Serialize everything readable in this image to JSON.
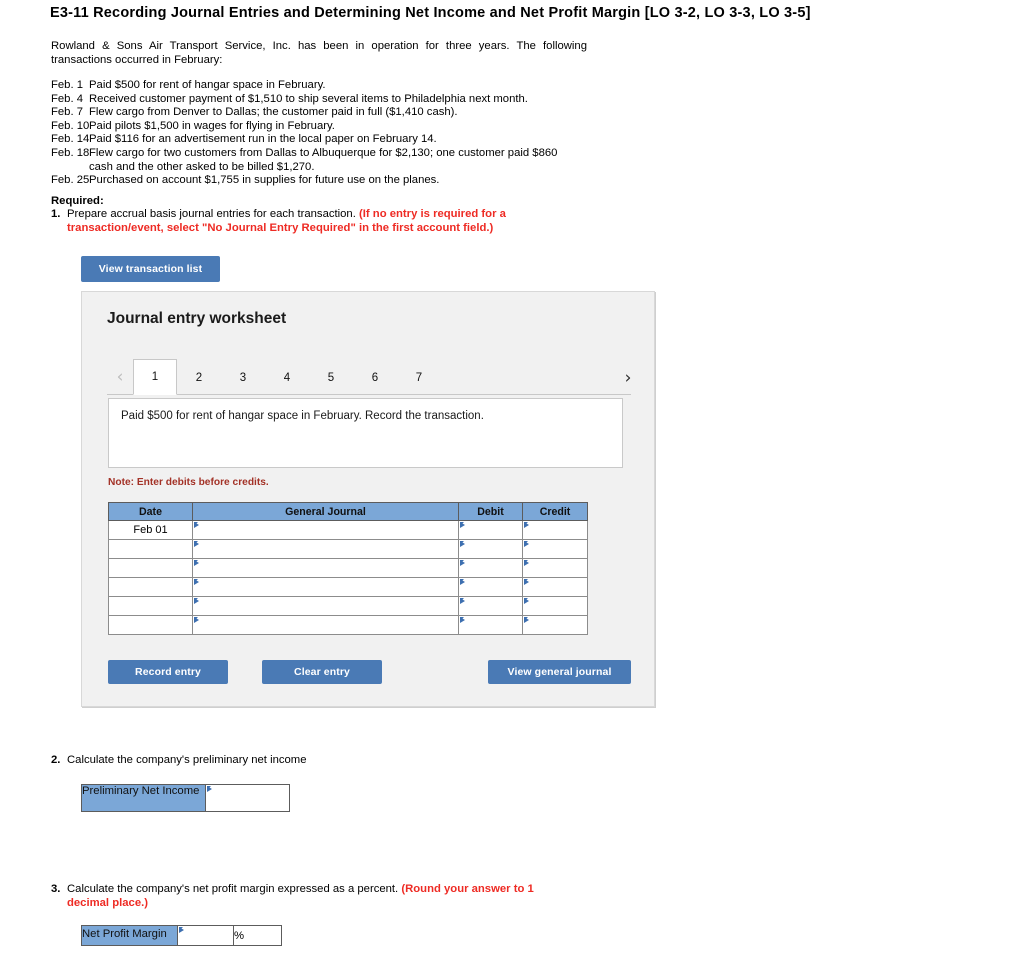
{
  "title": "E3-11 Recording Journal Entries and Determining Net Income and Net Profit Margin [LO 3-2, LO 3-3, LO 3-5]",
  "intro": "Rowland & Sons Air Transport Service, Inc. has been in operation for three years. The following transactions occurred in February:",
  "transactions": [
    {
      "date": "Feb. 1",
      "desc": "Paid $500 for rent of hangar space in February."
    },
    {
      "date": "Feb. 4",
      "desc": "Received customer payment of $1,510 to ship several items to Philadelphia next month."
    },
    {
      "date": "Feb. 7",
      "desc": "Flew cargo from Denver to Dallas; the customer paid in full ($1,410 cash)."
    },
    {
      "date": "Feb. 10",
      "desc": "Paid pilots $1,500 in wages for flying in February."
    },
    {
      "date": "Feb. 14",
      "desc": "Paid $116 for an advertisement run in the local paper on February 14."
    },
    {
      "date": "Feb. 18",
      "desc": "Flew cargo for two customers from Dallas to Albuquerque for $2,130; one customer paid $860",
      "cont": "cash and the other asked to be billed $1,270."
    },
    {
      "date": "Feb. 25",
      "desc": "Purchased on account $1,755 in supplies for future use on the planes."
    }
  ],
  "required": {
    "label": "Required:",
    "item1_num": "1.",
    "item1_text": "Prepare accrual basis journal entries for each transaction.",
    "item1_red_line1": "(If no entry is required for a",
    "item1_red_line2": "transaction/event, select \"No Journal Entry Required\" in the first account field.)"
  },
  "view_transaction_list_label": "View transaction list",
  "worksheet": {
    "title": "Journal entry worksheet",
    "prev_icon": "chevron-left-icon",
    "next_icon": "chevron-right-icon",
    "tabs": [
      "1",
      "2",
      "3",
      "4",
      "5",
      "6",
      "7"
    ],
    "active_tab": "1",
    "prompt": "Paid $500 for rent of hangar space in February. Record the transaction.",
    "note": "Note: Enter debits before credits.",
    "table": {
      "headers": [
        "Date",
        "General Journal",
        "Debit",
        "Credit"
      ],
      "rows": [
        {
          "date": "Feb 01",
          "general_journal": "",
          "debit": "",
          "credit": ""
        },
        {
          "date": "",
          "general_journal": "",
          "debit": "",
          "credit": ""
        },
        {
          "date": "",
          "general_journal": "",
          "debit": "",
          "credit": ""
        },
        {
          "date": "",
          "general_journal": "",
          "debit": "",
          "credit": ""
        },
        {
          "date": "",
          "general_journal": "",
          "debit": "",
          "credit": ""
        },
        {
          "date": "",
          "general_journal": "",
          "debit": "",
          "credit": ""
        }
      ]
    },
    "record_entry_label": "Record entry",
    "clear_entry_label": "Clear entry",
    "view_general_journal_label": "View general journal"
  },
  "question2": {
    "num": "2.",
    "text": "Calculate the company's preliminary net income",
    "row_label": "Preliminary Net Income",
    "value": ""
  },
  "question3": {
    "num": "3.",
    "text": "Calculate the company's net profit margin expressed as a percent.",
    "red_line1": "(Round your answer to 1",
    "red_line2": "decimal place.)",
    "row_label": "Net Profit Margin",
    "value": "",
    "percent_symbol": "%"
  },
  "colors": {
    "button_blue": "#4a7ab5",
    "header_blue": "#7ba7d7",
    "red_text": "#ee2b24",
    "note_red": "#a33227",
    "panel_bg": "#f1f1f1"
  }
}
